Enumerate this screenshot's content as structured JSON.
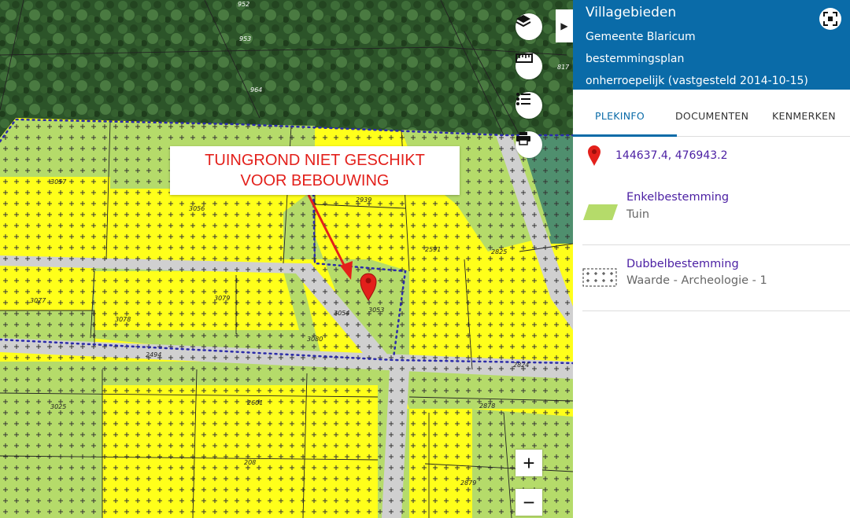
{
  "map": {
    "plot_numbers": [
      "952",
      "953",
      "964",
      "817",
      "2939",
      "3057",
      "3056",
      "2591",
      "2825",
      "3077",
      "3079",
      "3078",
      "3054",
      "3053",
      "3080",
      "2494",
      "2824",
      "3025",
      "2601",
      "2878",
      "208",
      "2879"
    ],
    "annotation": {
      "line1": "TUINGROND NIET GESCHIKT",
      "line2": "VOOR BEBOUWING",
      "color": "#e3201b"
    },
    "controls": {
      "layers_icon": "layers-icon",
      "measure_icon": "ruler-icon",
      "legend_icon": "list-icon",
      "print_icon": "printer-icon",
      "zoom_in": "+",
      "zoom_out": "−",
      "collapse_icon": "chevron-right-icon"
    },
    "colors": {
      "residential": "#ffff1a",
      "garden": "#b5db6a",
      "road": "#d0d0d0",
      "forest": "#2f5a2c",
      "boundary": "#2b2ba8"
    }
  },
  "panel": {
    "title": "Villagebieden",
    "municipality": "Gemeente Blaricum",
    "plan_type": "bestemmingsplan",
    "status": "onherroepelijk (vastgesteld 2014-10-15)",
    "header_color": "#0a6ba8",
    "tabs": [
      {
        "label": "PLEKINFO"
      },
      {
        "label": "DOCUMENTEN"
      },
      {
        "label": "KENMERKEN"
      }
    ],
    "coordinates": "144637.4, 476943.2",
    "items": [
      {
        "title": "Enkelbestemming",
        "subtitle": "Tuin",
        "icon": "garden-swatch-icon"
      },
      {
        "title": "Dubbelbestemming",
        "subtitle": "Waarde - Archeologie - 1",
        "icon": "archaeology-pattern-icon"
      }
    ]
  }
}
